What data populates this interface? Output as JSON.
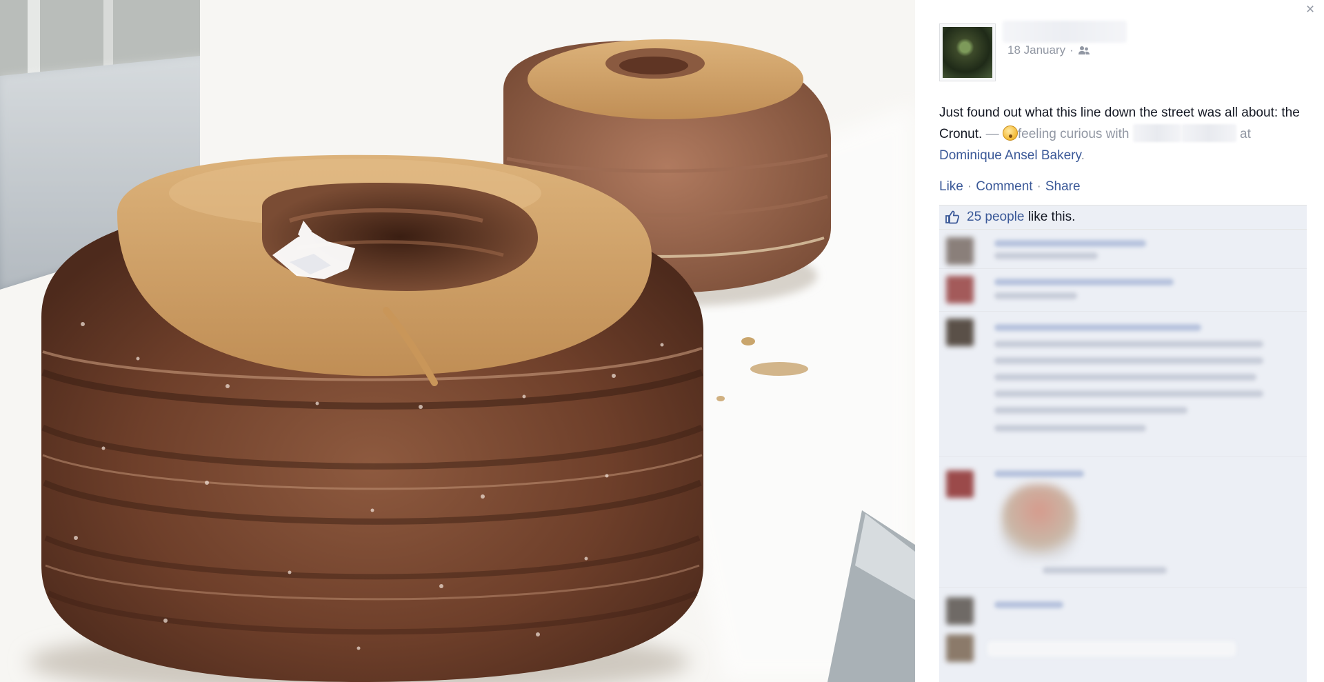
{
  "photo": {
    "description_icon": "cronut-photo"
  },
  "post": {
    "close_label": "×",
    "date": "18 January",
    "separator": " · ",
    "audience_icon": "friends-icon",
    "text_part1": "Just found out what this line down the street was all about: the Cronut.",
    "dash": " — ",
    "feeling": "feeling curious",
    "with_word": " with ",
    "at_word": " at ",
    "place": "Dominique Ansel Bakery",
    "period": "."
  },
  "actions": {
    "like": "Like",
    "comment": "Comment",
    "share": "Share",
    "dot": "·"
  },
  "likes": {
    "count_link": "25 people",
    "suffix": " like this."
  },
  "colors": {
    "link": "#3b5998",
    "muted": "#9197a3",
    "ufi_bg": "#eceff5"
  }
}
